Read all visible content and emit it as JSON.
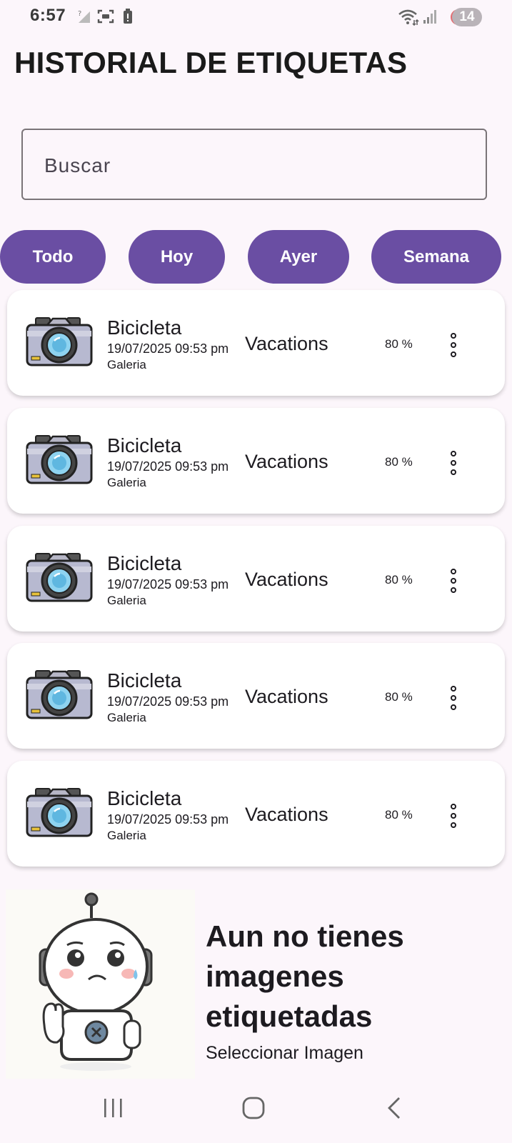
{
  "status_bar": {
    "time": "6:57",
    "battery_badge": "14"
  },
  "header": {
    "title": "HISTORIAL DE ETIQUETAS"
  },
  "search": {
    "placeholder": "Buscar"
  },
  "filters": [
    {
      "label": "Todo"
    },
    {
      "label": "Hoy"
    },
    {
      "label": "Ayer"
    },
    {
      "label": "Semana"
    }
  ],
  "history": [
    {
      "name": "Bicicleta",
      "date": "19/07/2025 09:53 pm",
      "source": "Galeria",
      "album": "Vacations",
      "confidence": "80 %"
    },
    {
      "name": "Bicicleta",
      "date": "19/07/2025 09:53 pm",
      "source": "Galeria",
      "album": "Vacations",
      "confidence": "80 %"
    },
    {
      "name": "Bicicleta",
      "date": "19/07/2025 09:53 pm",
      "source": "Galeria",
      "album": "Vacations",
      "confidence": "80 %"
    },
    {
      "name": "Bicicleta",
      "date": "19/07/2025 09:53 pm",
      "source": "Galeria",
      "album": "Vacations",
      "confidence": "80 %"
    },
    {
      "name": "Bicicleta",
      "date": "19/07/2025 09:53 pm",
      "source": "Galeria",
      "album": "Vacations",
      "confidence": "80 %"
    }
  ],
  "empty_state": {
    "message": "Aun no tienes imagenes etiquetadas",
    "action": "Seleccionar Imagen"
  },
  "colors": {
    "chip": "#6a4ea3",
    "background": "#fcf6fb",
    "card": "#ffffff"
  }
}
